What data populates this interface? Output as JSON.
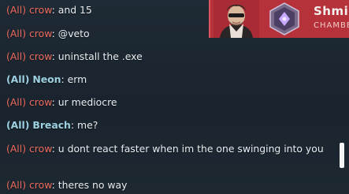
{
  "chat": {
    "messages": [
      {
        "tag": "(All)",
        "sender": "crow",
        "team": "enemy",
        "text": "and 15"
      },
      {
        "tag": "(All)",
        "sender": "crow",
        "team": "enemy",
        "text": "@veto"
      },
      {
        "tag": "(All)",
        "sender": "crow",
        "team": "enemy",
        "text": "uninstall the .exe"
      },
      {
        "tag": "(All)",
        "sender": "Neon",
        "team": "ally",
        "text": "erm"
      },
      {
        "tag": "(All)",
        "sender": "crow",
        "team": "enemy",
        "text": "ur mediocre"
      },
      {
        "tag": "(All)",
        "sender": "Breach",
        "team": "ally",
        "text": "me?"
      },
      {
        "tag": "(All)",
        "sender": "crow",
        "team": "enemy",
        "text": "u dont react faster when im the one swinging into you"
      },
      {
        "tag": "(All)",
        "sender": "crow",
        "team": "enemy",
        "text": "theres no way"
      }
    ]
  },
  "player_card": {
    "name": "Shmic",
    "agent": "CHAMBE",
    "card_color": "#b5323b"
  },
  "colors": {
    "enemy": "#f06c5f",
    "ally": "#9ed2e2",
    "text": "#e9eef1"
  }
}
